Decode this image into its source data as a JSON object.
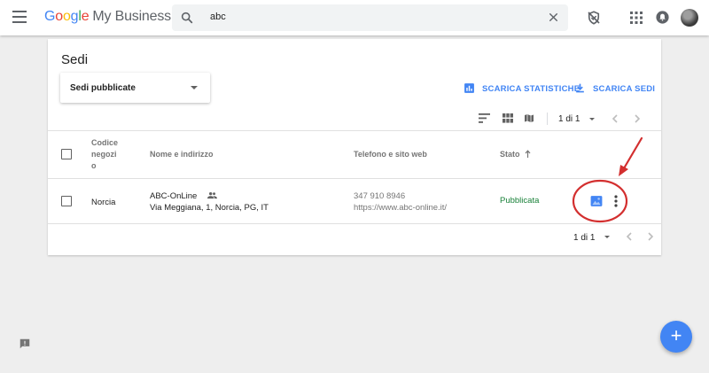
{
  "app": {
    "logo_letters": [
      "G",
      "o",
      "o",
      "g",
      "l",
      "e"
    ],
    "product_name": "My Business"
  },
  "search": {
    "value": "abc"
  },
  "page": {
    "title": "Sedi",
    "filter_selected": "Sedi pubblicate",
    "download_stats_label": "SCARICA STATISTICHE",
    "download_locations_label": "SCARICA SEDI",
    "pagination_top": "1 di 1",
    "pagination_bottom": "1 di 1"
  },
  "table": {
    "headers": {
      "code_line1": "Codice",
      "code_line2": "negozi",
      "code_line3": "o",
      "name_address": "Nome e indirizzo",
      "phone_web": "Telefono e sito web",
      "status": "Stato"
    },
    "rows": [
      {
        "code": "Norcia",
        "name": "ABC-OnLine",
        "address": "Via Meggiana, 1, Norcia, PG, IT",
        "phone": "347 910 8946",
        "website": "https://www.abc-online.it/",
        "status": "Pubblicata"
      }
    ]
  },
  "fab": {
    "label": "+"
  },
  "colors": {
    "accent": "#4285f4",
    "status_published": "#188038",
    "annotation": "#d32f2f"
  },
  "icons": [
    "menu-icon",
    "search-icon",
    "close-icon",
    "verified-off-icon",
    "apps-grid-icon",
    "notifications-icon",
    "bar-chart-icon",
    "download-icon",
    "sort-icon",
    "grid-view-icon",
    "map-view-icon",
    "people-icon",
    "post-icon",
    "more-vert-icon",
    "feedback-icon",
    "add-icon"
  ]
}
